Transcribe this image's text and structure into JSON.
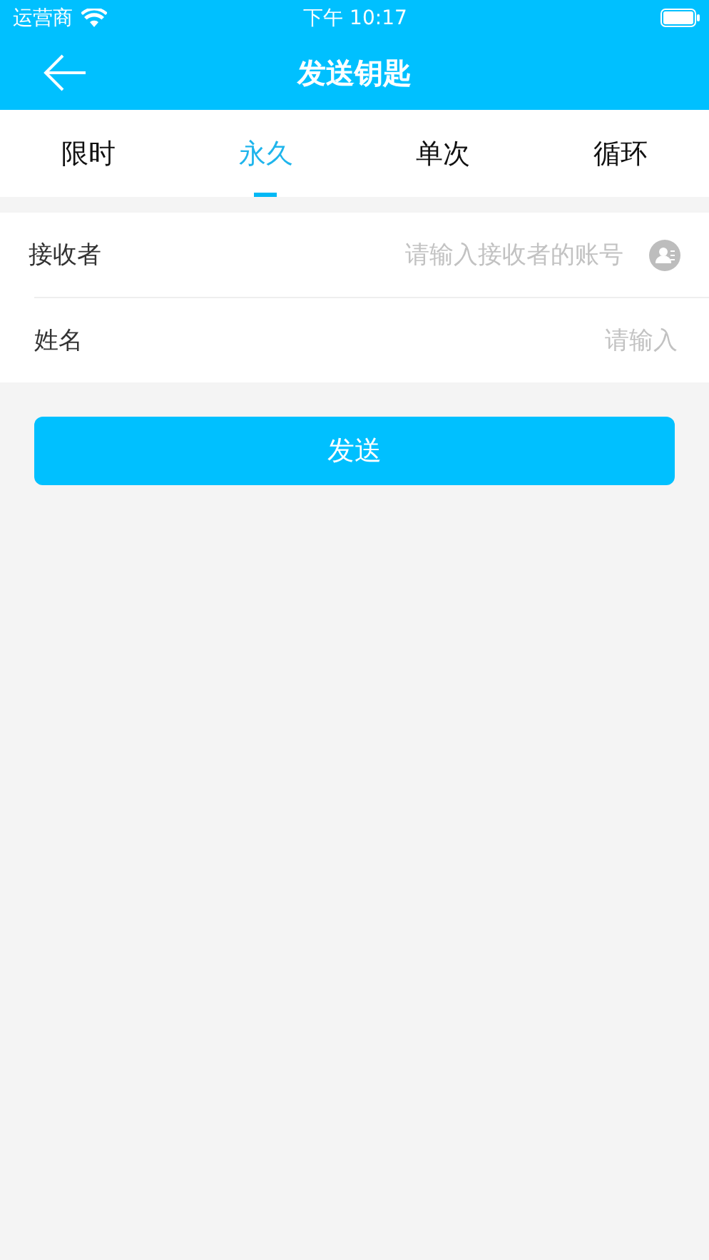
{
  "status_bar": {
    "carrier": "运营商",
    "time": "下午 10:17"
  },
  "nav": {
    "title": "发送钥匙"
  },
  "tabs": [
    {
      "label": "限时",
      "selected": false
    },
    {
      "label": "永久",
      "selected": true
    },
    {
      "label": "单次",
      "selected": false
    },
    {
      "label": "循环",
      "selected": false
    }
  ],
  "form": [
    {
      "label": "接收者",
      "placeholder": "请输入接收者的账号",
      "kind": "contact"
    },
    {
      "label": "姓名",
      "placeholder": "请输入",
      "kind": "text"
    }
  ],
  "button": "发送"
}
